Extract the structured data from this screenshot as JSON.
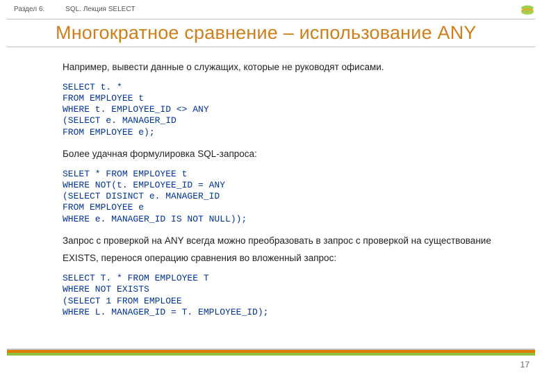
{
  "header": {
    "section": "Раздел 6.",
    "lecture": "SQL. Лекция SELECT"
  },
  "title": "Многократное сравнение – использование ANY",
  "intro": "Например, вывести данные о служащих, которые не руководят офисами.",
  "code1": "SELECT t. *\nFROM EMPLOYEE t\nWHERE t. EMPLOYEE_ID <> ANY\n(SELECT e. MANAGER_ID\nFROM EMPLOYEE e);",
  "para2": "Более удачная формулировка SQL-запроса:",
  "code2": "SELET * FROM EMPLOYEE t\nWHERE NOT(t. EMPLOYEE_ID = ANY\n(SELECT DISINCT e. MANAGER_ID\nFROM EMPLOYEE e\nWHERE e. MANAGER_ID IS NOT NULL));",
  "para3": "Запрос с проверкой на ANY всегда можно преобразовать в запрос с проверкой на существование EXISTS, перенося операцию сравнения во вложенный запрос:",
  "code3": "SELECT T. * FROM EMPLOYEE T\nWHERE NOT EXISTS\n(SELECT 1 FROM EMPLOEE\nWHERE L. MANAGER_ID = T. EMPLOYEE_ID);",
  "page_number": "17"
}
